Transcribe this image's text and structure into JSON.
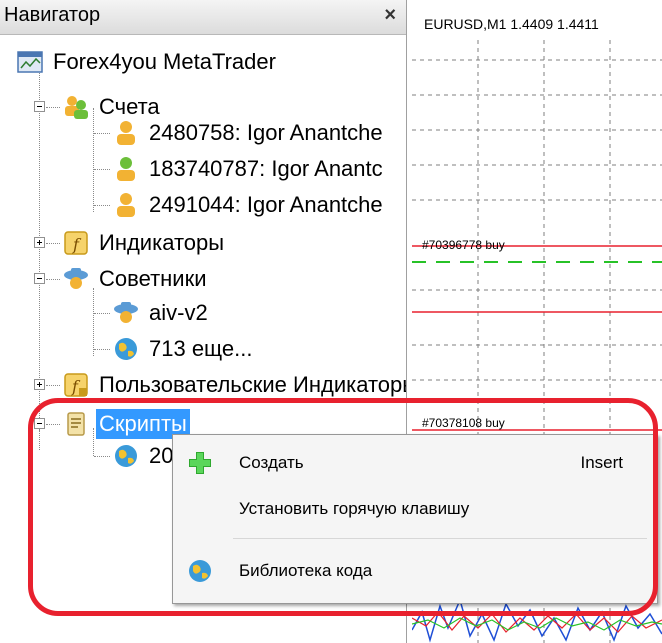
{
  "navigator": {
    "title": "Навигатор",
    "close_symbol": "×",
    "tree": {
      "root_label": "Forex4you MetaTrader",
      "accounts_label": "Счета",
      "accounts": [
        "2480758: Igor Anantche",
        "183740787: Igor Anantc",
        "2491044: Igor Anantche"
      ],
      "indicators_label": "Индикаторы",
      "experts_label": "Советники",
      "experts": [
        "aiv-v2",
        "713 еще..."
      ],
      "custom_indicators_label": "Пользовательские Индикаторы",
      "scripts_label": "Скрипты",
      "scripts_child_label": "20"
    }
  },
  "chart": {
    "title": "EURUSD,M1  1.4409 1.4411",
    "order_labels": [
      "#70396778 buy",
      "#70378108 buy"
    ],
    "colors": {
      "order_line": "#e8212e",
      "dashed_line": "#27c227",
      "grid": "#7f7f7f"
    }
  },
  "context_menu": {
    "items": [
      {
        "label": "Создать",
        "shortcut": "Insert",
        "icon": "plus-icon"
      },
      {
        "label": "Установить горячую клавишу",
        "shortcut": "",
        "icon": ""
      },
      {
        "label": "Библиотека кода",
        "shortcut": "",
        "icon": "globe-icon"
      }
    ]
  },
  "highlight_color": "#e8212e"
}
